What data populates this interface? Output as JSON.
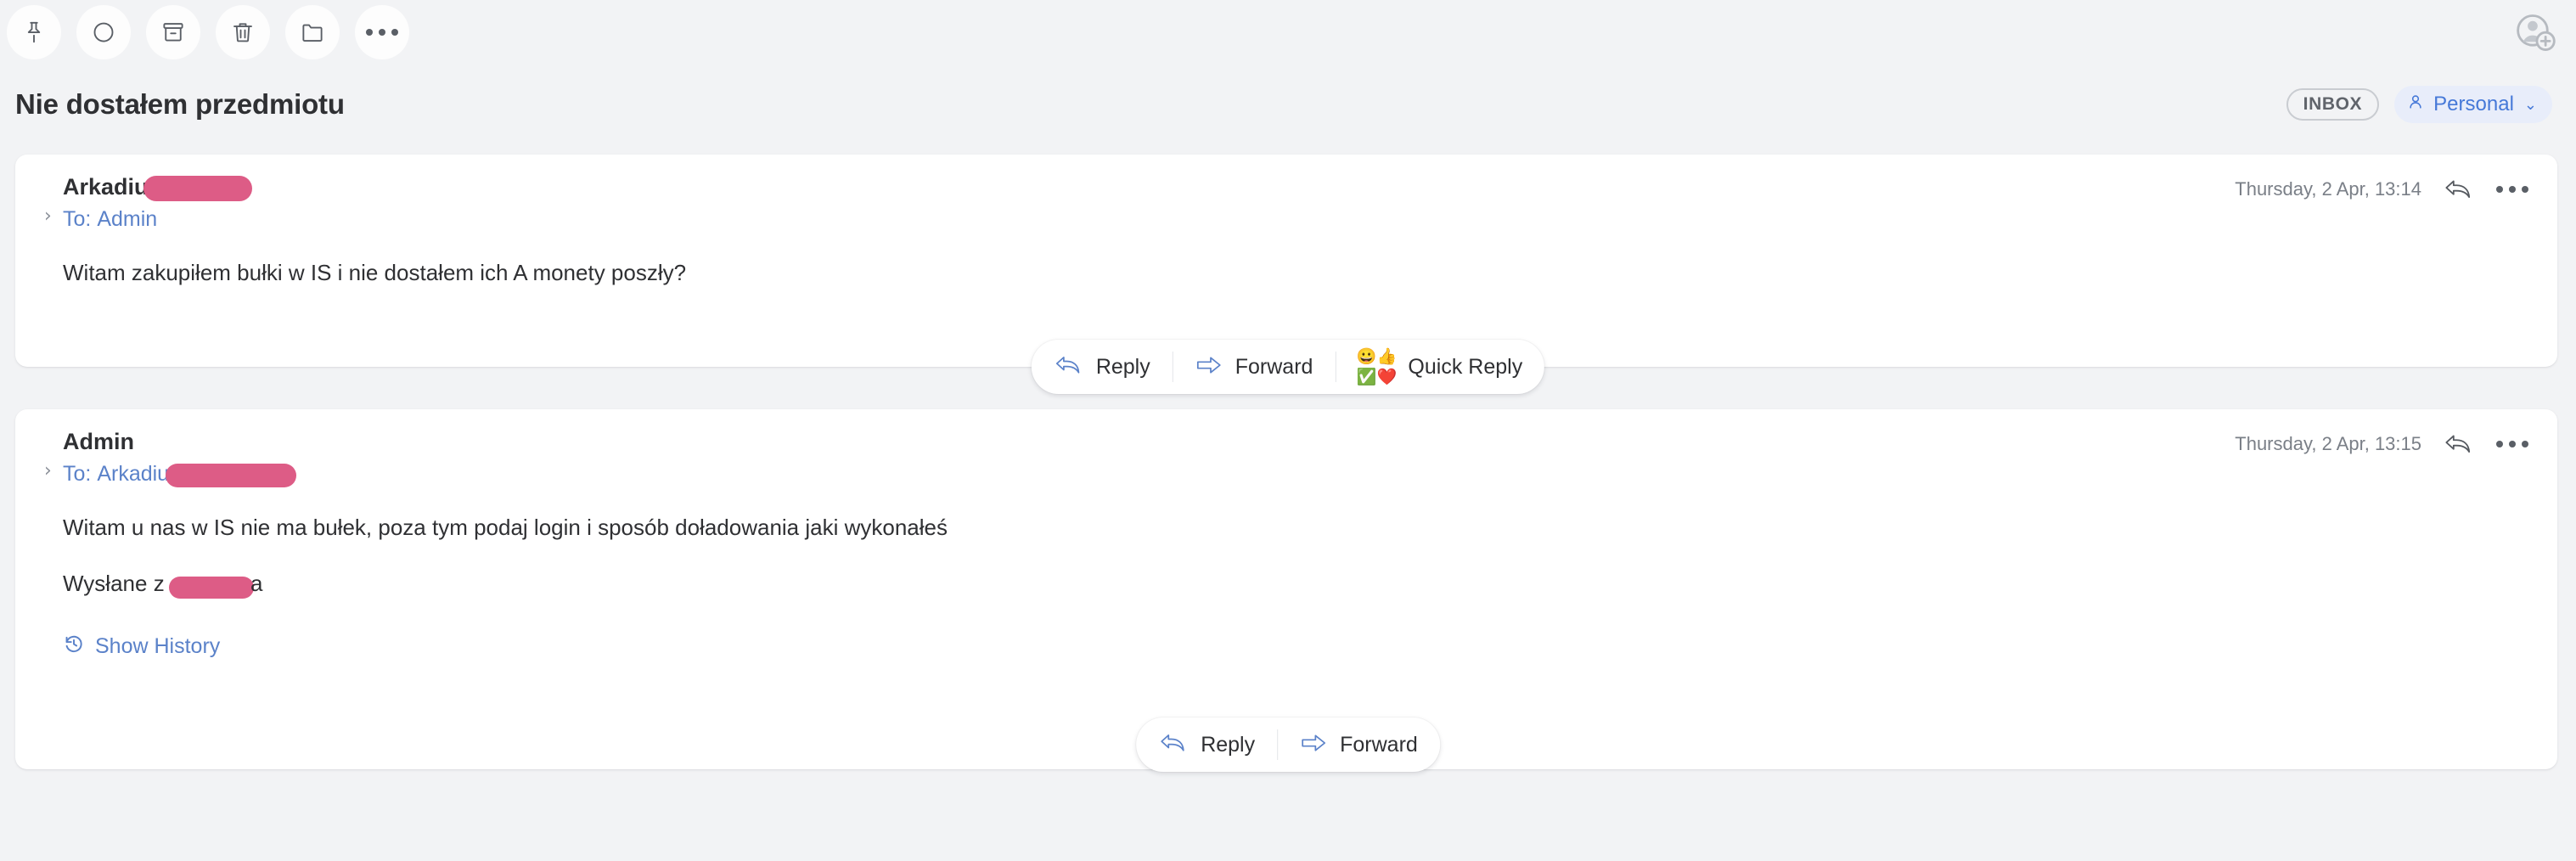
{
  "toolbar": {
    "buttons": [
      {
        "name": "pin-icon",
        "label": "Pin"
      },
      {
        "name": "mark-unread-icon",
        "label": "Mark as unread"
      },
      {
        "name": "archive-icon",
        "label": "Archive"
      },
      {
        "name": "delete-icon",
        "label": "Delete"
      },
      {
        "name": "move-to-folder-icon",
        "label": "Move to folder"
      },
      {
        "name": "more-options-icon",
        "label": "More"
      }
    ],
    "avatar_label": "Add contact"
  },
  "header": {
    "subject": "Nie dostałem przedmiotu",
    "inbox_pill": "INBOX",
    "account_pill": "Personal",
    "account_chevron": "⌄"
  },
  "colors": {
    "page_background": "#f2f3f5",
    "card_background": "#ffffff",
    "accent_blue": "#4679d8",
    "link_blue": "#5b82c9",
    "redaction_pink": "#dd5c86",
    "text_primary": "#2f3033",
    "text_muted": "#7a7f87"
  },
  "messages": [
    {
      "sender": "Arkadiu",
      "sender_redacted": true,
      "to_prefix": "To:",
      "to_name": "Admin",
      "to_redacted": false,
      "timestamp": "Thursday, 2 Apr, 13:14",
      "expand_chevron": "›",
      "body": "Witam zakupiłem bułki w IS i nie dostałem ich A monety poszły?",
      "signature": null,
      "show_history": null
    },
    {
      "sender": "Admin",
      "sender_redacted": false,
      "to_prefix": "To:",
      "to_name": "Arkadiu",
      "to_redacted": true,
      "timestamp": "Thursday, 2 Apr, 13:15",
      "expand_chevron": "›",
      "body": "Witam u nas w IS nie ma bułek, poza tym podaj login i sposób doładowania jaki wykonałeś",
      "signature_prefix": "Wysłane z",
      "signature_suffix": "a",
      "show_history": "Show History"
    }
  ],
  "action_bars": [
    {
      "actions": [
        {
          "name": "reply-action",
          "label": "Reply",
          "icon": "reply-arrow-icon"
        },
        {
          "name": "forward-action",
          "label": "Forward",
          "icon": "forward-arrow-icon"
        },
        {
          "name": "quick-reply-action",
          "label": "Quick Reply",
          "icon": "emoji-cluster-icon"
        }
      ],
      "emojis": [
        "😀",
        "👍",
        "✅",
        "❤️"
      ]
    },
    {
      "actions": [
        {
          "name": "reply-action",
          "label": "Reply",
          "icon": "reply-arrow-icon"
        },
        {
          "name": "forward-action",
          "label": "Forward",
          "icon": "forward-arrow-icon"
        }
      ]
    }
  ]
}
